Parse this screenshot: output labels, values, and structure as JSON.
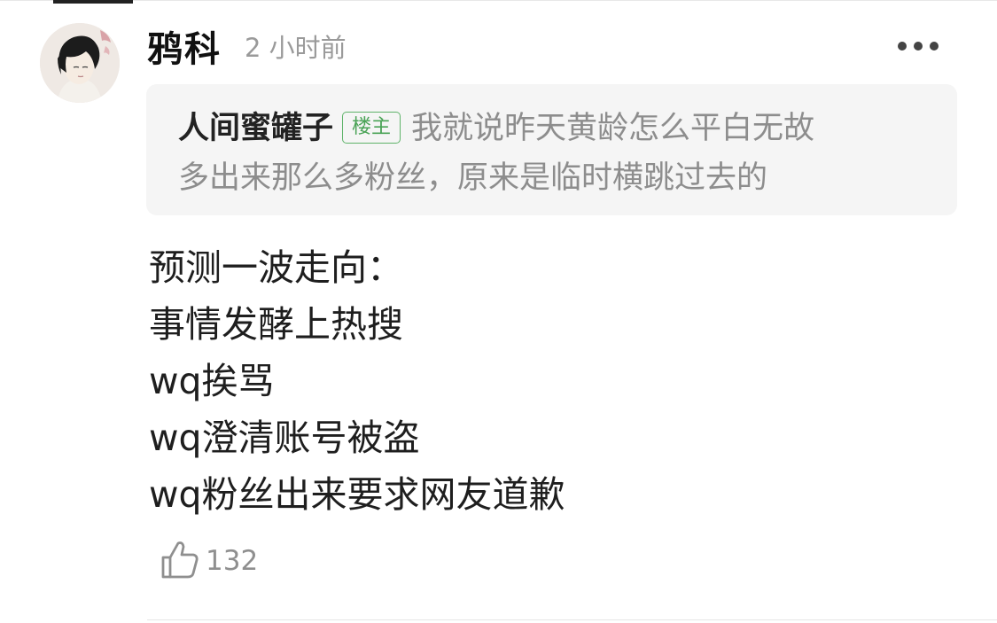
{
  "comment": {
    "author": "鸦科",
    "time": "2 小时前",
    "more_icon": "more-horizontal-icon"
  },
  "quote": {
    "author": "人间蜜罐子",
    "badge": "楼主",
    "line1": "我就说昨天黄龄怎么平白无故",
    "line2": "多出来那么多粉丝，原来是临时横跳过去的"
  },
  "body": {
    "lines": [
      "预测一波走向：",
      "事情发酵上热搜",
      "wq挨骂",
      "wq澄清账号被盗",
      "wq粉丝出来要求网友道歉"
    ]
  },
  "actions": {
    "like_icon": "thumbs-up-icon",
    "like_count": "132"
  },
  "colors": {
    "badge": "#4aa356",
    "quote_bg": "#f5f5f5",
    "muted_text": "#8d8d8d"
  }
}
